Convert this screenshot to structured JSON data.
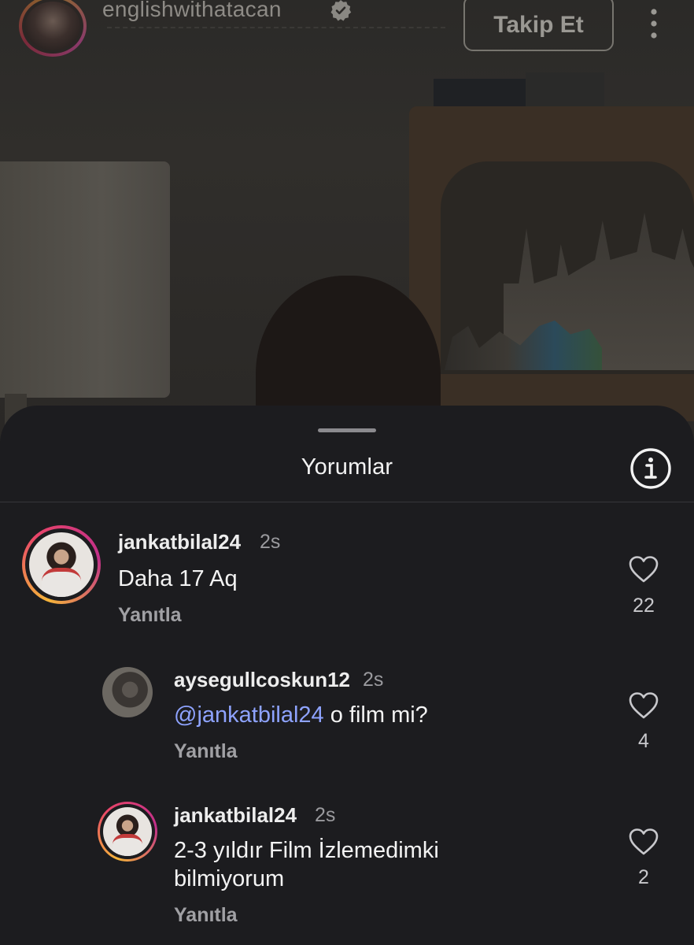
{
  "header": {
    "username": "englishwithatacan",
    "follow_label": "Takip Et"
  },
  "sheet": {
    "title": "Yorumlar"
  },
  "comments": [
    {
      "username": "jankatbilal24",
      "time": "2s",
      "mention": "",
      "text": "Daha 17 Aq",
      "reply_label": "Yanıtla",
      "likes": "22"
    },
    {
      "username": "aysegullcoskun12",
      "time": "2s",
      "mention": "@jankatbilal24",
      "text": " o film mi?",
      "reply_label": "Yanıtla",
      "likes": "4"
    },
    {
      "username": "jankatbilal24",
      "time": "2s",
      "mention": "",
      "text": "2-3 yıldır Film İzlemedimki bilmiyorum",
      "reply_label": "Yanıtla",
      "likes": "2"
    }
  ],
  "icons": {
    "verified": "verified-badge-icon",
    "more": "more-vertical-icon",
    "info": "info-icon",
    "like": "heart-outline-icon"
  },
  "colors": {
    "sheet_bg": "#1c1c1f",
    "mention": "#8ea3ff",
    "story_ring_start": "#f5b43a",
    "story_ring_end": "#c12f8a"
  }
}
